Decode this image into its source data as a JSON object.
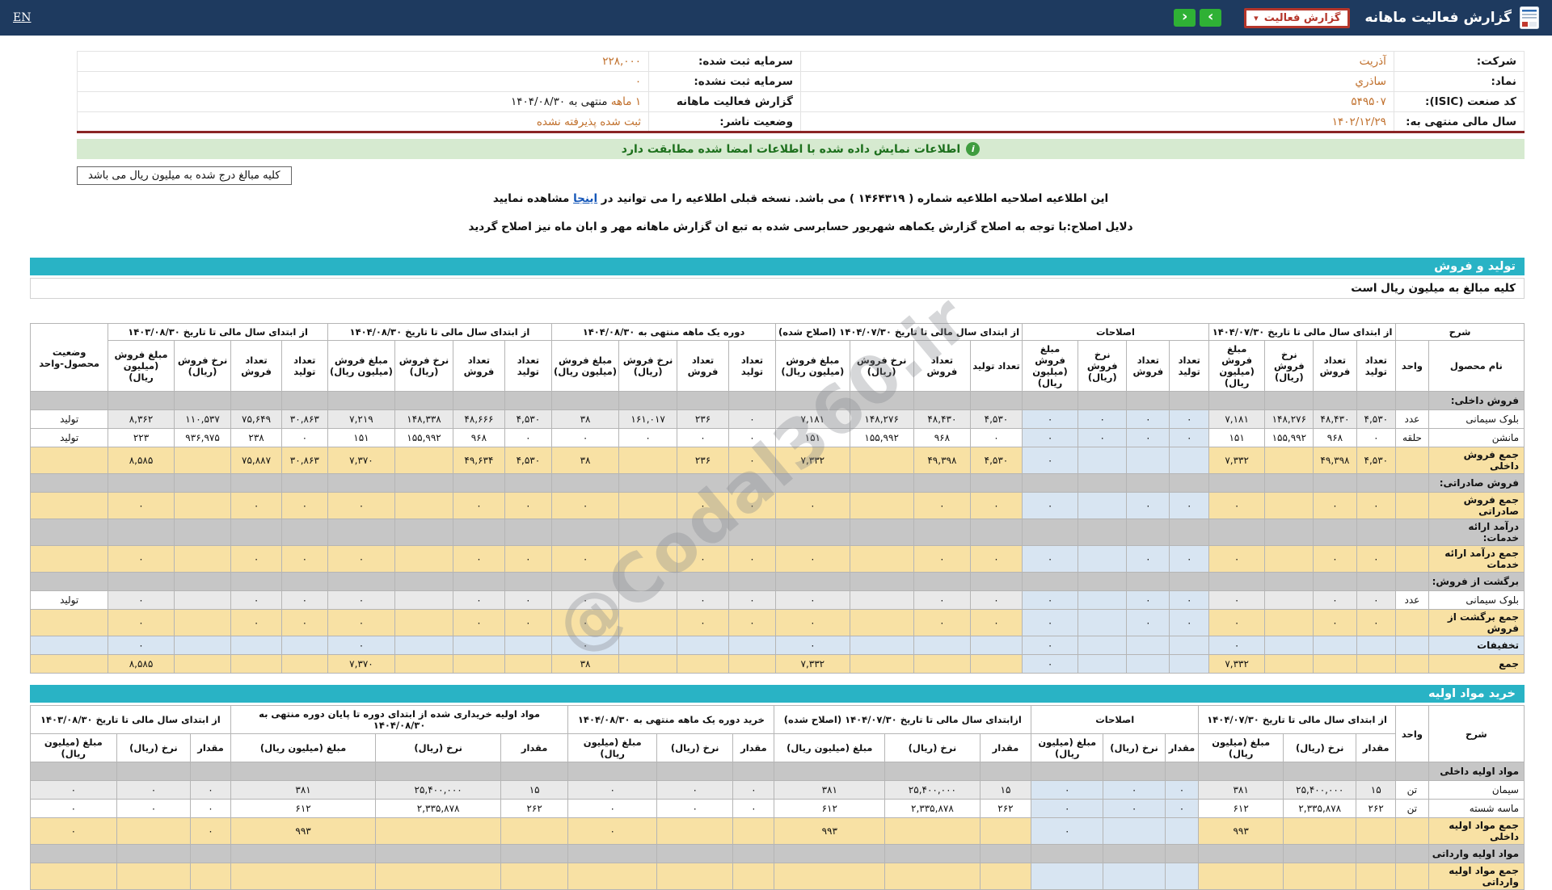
{
  "header": {
    "title": "گزارش فعالیت ماهانه",
    "dropdown_label": "گزارش فعالیت",
    "nav_forward": "›",
    "nav_back": "‹",
    "lang_link": "EN"
  },
  "colors": {
    "navbar": "#1e3a5f",
    "accent_red": "#b5362b",
    "accent_green": "#2fb135",
    "cyan_bar": "#29b3c5",
    "value_orange": "#c06f2b",
    "banner_bg": "#d6ead0",
    "sum_row": "#f8e1a4",
    "adjust_col": "#d8e5f2"
  },
  "info": {
    "rows": [
      {
        "r_label": "شرکت:",
        "r_value": "آذریت",
        "l_label": "سرمایه ثبت شده:",
        "l_value": "۲۲۸,۰۰۰",
        "l_suffix": ""
      },
      {
        "r_label": "نماد:",
        "r_value": "ساذري",
        "l_label": "سرمایه ثبت نشده:",
        "l_value": "۰",
        "l_suffix": ""
      },
      {
        "r_label": "کد صنعت (ISIC):",
        "r_value": "۵۴۹۵۰۷",
        "l_label": "گزارش فعالیت ماهانه",
        "l_value": "۱ ماهه",
        "l_suffix": "منتهی به ۱۴۰۴/۰۸/۳۰"
      },
      {
        "r_label": "سال مالی منتهی به:",
        "r_value": "۱۴۰۲/۱۲/۲۹",
        "l_label": "وضعیت ناشر:",
        "l_value": "ثبت شده پذیرفته نشده",
        "l_suffix": ""
      }
    ]
  },
  "banner": {
    "text": "اطلاعات نمایش داده شده با اطلاعات امضا شده مطابقت دارد"
  },
  "notes": {
    "amounts_box": "کلیه مبالغ درج شده به میلیون ریال می باشد",
    "amendment_pre": "این اطلاعیه اصلاحیه اطلاعیه شماره ( ۱۴۶۴۳۱۹ ) می باشد. نسخه قبلی اطلاعیه را می توانید در ",
    "amendment_link": "اینجا",
    "amendment_post": " مشاهده نمایید",
    "reason": "دلایل اصلاح:با توجه به اصلاح گزارش یکماهه شهریور حسابرسی شده به تبع ان گزارش ماهانه مهر و ابان ماه نیز اصلاح گردید"
  },
  "production_section": {
    "title": "تولید و فروش",
    "subtitle": "کلیه مبالغ به میلیون ریال است"
  },
  "materials_section": {
    "title": "خرید مواد اولیه"
  },
  "watermark": "@Codal360.ir",
  "production_table": {
    "corner_title": "شرح",
    "name_col": "نام محصول",
    "unit_col": "واحد",
    "status_col": "وضعیت محصول-واحد",
    "subcols": [
      "تعداد تولید",
      "تعداد فروش",
      "نرخ فروش (ریال)",
      "مبلغ فروش (میلیون ریال)"
    ],
    "groups": [
      {
        "title": "از ابتدای سال مالی تا تاریخ ۱۴۰۴/۰۷/۳۰"
      },
      {
        "title": "اصلاحات"
      },
      {
        "title": "از ابتدای سال مالی تا تاریخ ۱۴۰۴/۰۷/۳۰ (اصلاح شده)"
      },
      {
        "title": "دوره یک ماهه منتهی به ۱۴۰۴/۰۸/۳۰"
      },
      {
        "title": "از ابتدای سال مالی تا تاریخ ۱۴۰۴/۰۸/۳۰"
      },
      {
        "title": "از ابتدای سال مالی تا تاریخ ۱۴۰۳/۰۸/۳۰"
      }
    ],
    "rows": [
      {
        "type": "section",
        "name": "فروش داخلی:"
      },
      {
        "type": "data",
        "shade": "alt",
        "name": "بلوک سیمانی",
        "unit": "عدد",
        "status": "تولید",
        "cells": [
          "۴,۵۳۰",
          "۴۸,۴۳۰",
          "۱۴۸,۲۷۶",
          "۷,۱۸۱",
          "۰",
          "۰",
          "۰",
          "۰",
          "۴,۵۳۰",
          "۴۸,۴۳۰",
          "۱۴۸,۲۷۶",
          "۷,۱۸۱",
          "۰",
          "۲۳۶",
          "۱۶۱,۰۱۷",
          "۳۸",
          "۴,۵۳۰",
          "۴۸,۶۶۶",
          "۱۴۸,۳۳۸",
          "۷,۲۱۹",
          "۳۰,۸۶۳",
          "۷۵,۶۴۹",
          "۱۱۰,۵۳۷",
          "۸,۳۶۲"
        ]
      },
      {
        "type": "data",
        "shade": "white",
        "name": "مانشن",
        "unit": "حلقه",
        "status": "تولید",
        "cells": [
          "۰",
          "۹۶۸",
          "۱۵۵,۹۹۲",
          "۱۵۱",
          "۰",
          "۰",
          "۰",
          "۰",
          "۰",
          "۹۶۸",
          "۱۵۵,۹۹۲",
          "۱۵۱",
          "۰",
          "۰",
          "۰",
          "۰",
          "۰",
          "۹۶۸",
          "۱۵۵,۹۹۲",
          "۱۵۱",
          "۰",
          "۲۳۸",
          "۹۳۶,۹۷۵",
          "۲۲۳"
        ]
      },
      {
        "type": "sum",
        "name": "جمع فروش داخلی",
        "cells": [
          "۴,۵۳۰",
          "۴۹,۳۹۸",
          "",
          "۷,۳۳۲",
          "",
          "",
          "",
          "۰",
          "۴,۵۳۰",
          "۴۹,۳۹۸",
          "",
          "۷,۳۳۲",
          "۰",
          "۲۳۶",
          "",
          "۳۸",
          "۴,۵۳۰",
          "۴۹,۶۳۴",
          "",
          "۷,۳۷۰",
          "۳۰,۸۶۳",
          "۷۵,۸۸۷",
          "",
          "۸,۵۸۵"
        ]
      },
      {
        "type": "section",
        "name": "فروش صادراتی:"
      },
      {
        "type": "sum",
        "name": "جمع فروش صادراتی",
        "cells": [
          "۰",
          "۰",
          "",
          "۰",
          "۰",
          "۰",
          "",
          "۰",
          "۰",
          "۰",
          "",
          "۰",
          "۰",
          "۰",
          "",
          "۰",
          "۰",
          "۰",
          "",
          "۰",
          "۰",
          "۰",
          "",
          "۰"
        ]
      },
      {
        "type": "section",
        "name": "درآمد ارائه خدمات:"
      },
      {
        "type": "sum",
        "name": "جمع درآمد ارائه خدمات",
        "cells": [
          "۰",
          "۰",
          "",
          "۰",
          "۰",
          "۰",
          "",
          "۰",
          "۰",
          "۰",
          "",
          "۰",
          "۰",
          "۰",
          "",
          "۰",
          "۰",
          "۰",
          "",
          "۰",
          "۰",
          "۰",
          "",
          "۰"
        ]
      },
      {
        "type": "section",
        "name": "برگشت از فروش:"
      },
      {
        "type": "data",
        "shade": "alt",
        "name": "بلوک سیمانی",
        "unit": "عدد",
        "status": "تولید",
        "cells": [
          "۰",
          "۰",
          "",
          "۰",
          "۰",
          "۰",
          "",
          "۰",
          "۰",
          "۰",
          "",
          "۰",
          "۰",
          "۰",
          "",
          "۰",
          "۰",
          "۰",
          "",
          "۰",
          "۰",
          "۰",
          "",
          "۰"
        ]
      },
      {
        "type": "sum",
        "name": "جمع برگشت از فروش",
        "cells": [
          "۰",
          "۰",
          "",
          "۰",
          "۰",
          "۰",
          "",
          "۰",
          "۰",
          "۰",
          "",
          "۰",
          "۰",
          "۰",
          "",
          "۰",
          "۰",
          "۰",
          "",
          "۰",
          "۰",
          "۰",
          "",
          "۰"
        ]
      },
      {
        "type": "discount",
        "name": "تخفیفات",
        "cells": [
          "",
          "",
          "",
          "۰",
          "",
          "",
          "",
          "۰",
          "",
          "",
          "",
          "۰",
          "",
          "",
          "",
          "۰",
          "",
          "",
          "",
          "۰",
          "",
          "",
          "",
          "۰"
        ]
      },
      {
        "type": "sum",
        "name": "جمع",
        "cells": [
          "",
          "",
          "",
          "۷,۳۳۲",
          "",
          "",
          "",
          "۰",
          "",
          "",
          "",
          "۷,۳۳۲",
          "",
          "",
          "",
          "۳۸",
          "",
          "",
          "",
          "۷,۳۷۰",
          "",
          "",
          "",
          "۸,۵۸۵"
        ]
      }
    ]
  },
  "materials_table": {
    "corner_title": "شرح",
    "unit_col": "واحد",
    "subcols": [
      "مقدار",
      "نرخ (ریال)",
      "مبلغ (میلیون ریال)"
    ],
    "groups": [
      {
        "title": "از ابتدای سال مالی تا تاریخ ۱۴۰۴/۰۷/۳۰"
      },
      {
        "title": "اصلاحات"
      },
      {
        "title": "ازابتدای سال مالی تا تاریخ ۱۴۰۴/۰۷/۳۰ (اصلاح شده)"
      },
      {
        "title": "خرید دوره یک ماهه منتهی به ۱۴۰۴/۰۸/۳۰"
      },
      {
        "title": "مواد اولیه خریداری شده از ابتدای دوره تا پایان دوره منتهی به ۱۴۰۴/۰۸/۳۰"
      },
      {
        "title": "از ابتدای سال مالی تا تاریخ ۱۴۰۳/۰۸/۳۰"
      }
    ],
    "rows": [
      {
        "type": "section",
        "name": "مواد اولیه داخلی"
      },
      {
        "type": "data",
        "shade": "alt",
        "name": "سیمان",
        "unit": "تن",
        "cells": [
          "۱۵",
          "۲۵,۴۰۰,۰۰۰",
          "۳۸۱",
          "۰",
          "۰",
          "۰",
          "۱۵",
          "۲۵,۴۰۰,۰۰۰",
          "۳۸۱",
          "۰",
          "۰",
          "۰",
          "۱۵",
          "۲۵,۴۰۰,۰۰۰",
          "۳۸۱",
          "۰",
          "۰",
          "۰"
        ]
      },
      {
        "type": "data",
        "shade": "white",
        "name": "ماسه شسته",
        "unit": "تن",
        "cells": [
          "۲۶۲",
          "۲,۳۳۵,۸۷۸",
          "۶۱۲",
          "۰",
          "۰",
          "۰",
          "۲۶۲",
          "۲,۳۳۵,۸۷۸",
          "۶۱۲",
          "۰",
          "۰",
          "۰",
          "۲۶۲",
          "۲,۳۳۵,۸۷۸",
          "۶۱۲",
          "۰",
          "۰",
          "۰"
        ]
      },
      {
        "type": "sum",
        "name": "جمع مواد اولیه داخلی",
        "cells": [
          "",
          "",
          "۹۹۳",
          "",
          "",
          "۰",
          "",
          "",
          "۹۹۳",
          "",
          "",
          "۰",
          "",
          "",
          "۹۹۳",
          "۰",
          "",
          "۰"
        ]
      },
      {
        "type": "section",
        "name": "مواد اولیه وارداتی"
      },
      {
        "type": "sum",
        "name": "جمع مواد اولیه وارداتی",
        "cells": [
          "",
          "",
          "",
          "",
          "",
          "",
          "",
          "",
          "",
          "",
          "",
          "",
          "",
          "",
          "",
          "",
          "",
          ""
        ]
      }
    ]
  }
}
